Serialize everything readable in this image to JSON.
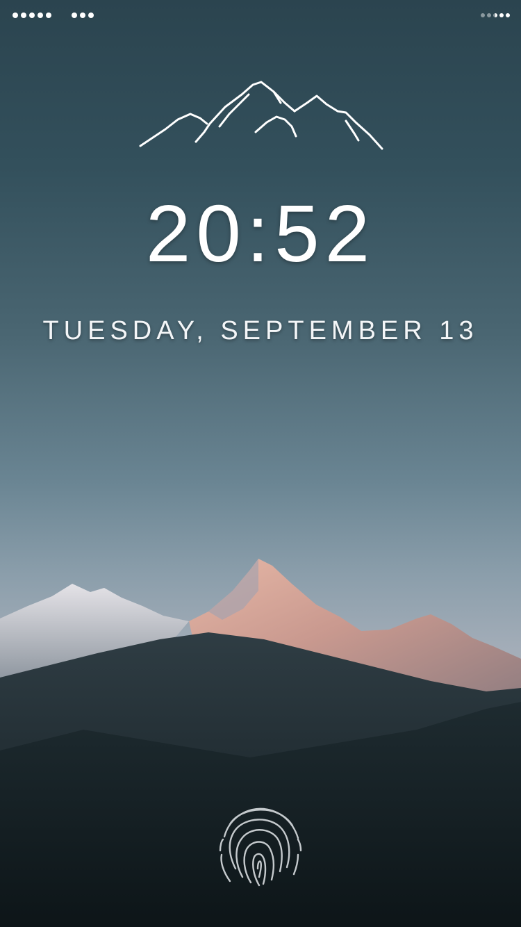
{
  "lock_screen": {
    "time": "20:52",
    "date": "TUESDAY, SEPTEMBER 13"
  },
  "status_bar": {
    "signal_strength_dots": 5,
    "wifi_dots": 3,
    "battery_level": 0.5
  },
  "icons": {
    "logo": "mountain-logo-icon",
    "unlock": "fingerprint-icon",
    "signal": "signal-dots-icon",
    "wifi": "wifi-dots-icon",
    "battery": "battery-dots-icon"
  },
  "colors": {
    "text": "#ffffff",
    "sky_top": "#2b444f",
    "sky_horizon": "#b2b3bb",
    "foreground": "#1a2a31"
  }
}
